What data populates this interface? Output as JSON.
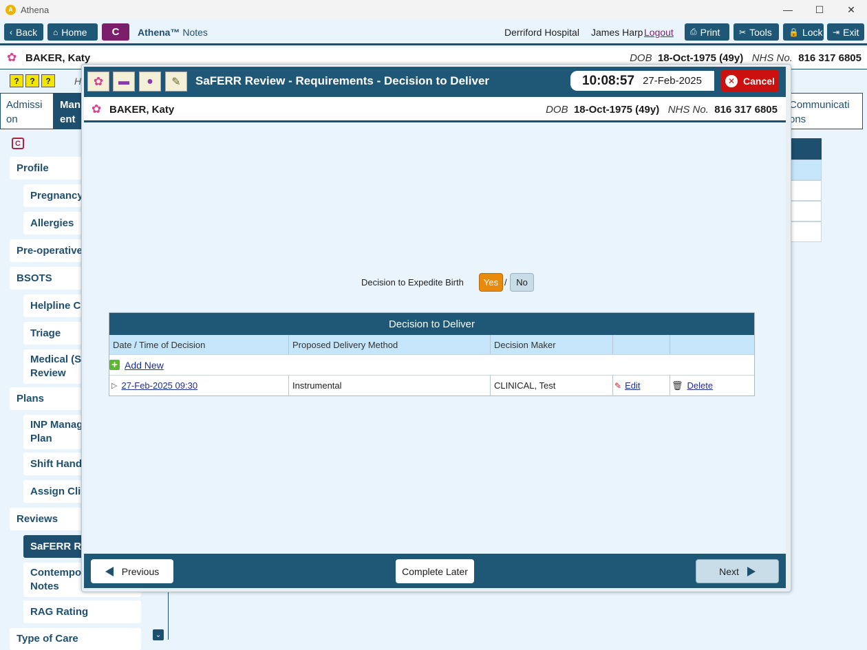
{
  "window": {
    "title": "Athena",
    "logo": "A",
    "minimize": "—",
    "maximize": "☐",
    "close": "✕"
  },
  "nav": {
    "back": "Back",
    "home": "Home",
    "c_badge": "C",
    "brand": "Athena™",
    "brand_suffix": " Notes",
    "hospital": "Derriford Hospital",
    "user": "James Harp",
    "logout": "Logout",
    "print": "Print",
    "tools": "Tools",
    "lock": "Lock",
    "exit": "Exit",
    "back_icon": "‹",
    "home_icon": "⌂",
    "print_icon": "⎙",
    "tools_icon": "✂",
    "lock_icon": "🔒",
    "exit_icon": "⇥"
  },
  "patient": {
    "name": "BAKER, Katy",
    "dob_label": "DOB",
    "dob": "18-Oct-1975 (49y)",
    "nhs_label": "NHS No.",
    "nhs": "816 317 6805",
    "icon": "✿"
  },
  "strip": {
    "icons": [
      "?",
      "?",
      "?"
    ],
    "partial_text": "H"
  },
  "tabs": {
    "left": "Admissi\non",
    "active": "Man\nent",
    "right": "Communicati\nons"
  },
  "sidebar": {
    "c_icon": "C",
    "items": [
      {
        "label": "Profile"
      },
      {
        "label": "Pregnancy"
      },
      {
        "label": "Allergies"
      },
      {
        "label": "Pre-operative"
      },
      {
        "label": "BSOTS"
      },
      {
        "label": "Helpline Co"
      },
      {
        "label": "Triage"
      },
      {
        "label": "Medical (Sa\nReview"
      },
      {
        "label": "Plans"
      },
      {
        "label": "INP Manag\nPlan"
      },
      {
        "label": "Shift Hando"
      },
      {
        "label": "Assign Clin"
      },
      {
        "label": "Reviews"
      },
      {
        "label": "SaFERR Rev"
      },
      {
        "label": "Contempor\nNotes"
      },
      {
        "label": "RAG Rating"
      },
      {
        "label": "Type of Care"
      }
    ],
    "scroll_icon": "⌄"
  },
  "modal": {
    "title": "SaFERR Review - Requirements - Decision to Deliver",
    "time": "10:08:57",
    "date": "27-Feb-2025",
    "cancel": "Cancel",
    "cancel_icon": "✕",
    "header_icons": [
      "✿",
      "▬",
      "●",
      "✎"
    ],
    "expedite": {
      "label": "Decision to Expedite Birth",
      "yes": "Yes",
      "slash": "/",
      "no": "No",
      "selected": "Yes"
    },
    "table": {
      "title": "Decision to Deliver",
      "columns": [
        "Date / Time of Decision",
        "Proposed Delivery Method",
        "Decision Maker",
        "",
        ""
      ],
      "add_new": "Add New",
      "rows": [
        {
          "date": "27-Feb-2025 09:30",
          "method": "Instrumental",
          "maker": "CLINICAL, Test",
          "edit": "Edit",
          "delete": "Delete"
        }
      ]
    },
    "footer": {
      "previous": "Previous",
      "complete_later": "Complete Later",
      "next": "Next"
    }
  },
  "colors": {
    "primary": "#1e5876",
    "accent_orange": "#e88a0c",
    "cancel_red": "#cc1010",
    "brand_purple": "#7b1f6d"
  }
}
